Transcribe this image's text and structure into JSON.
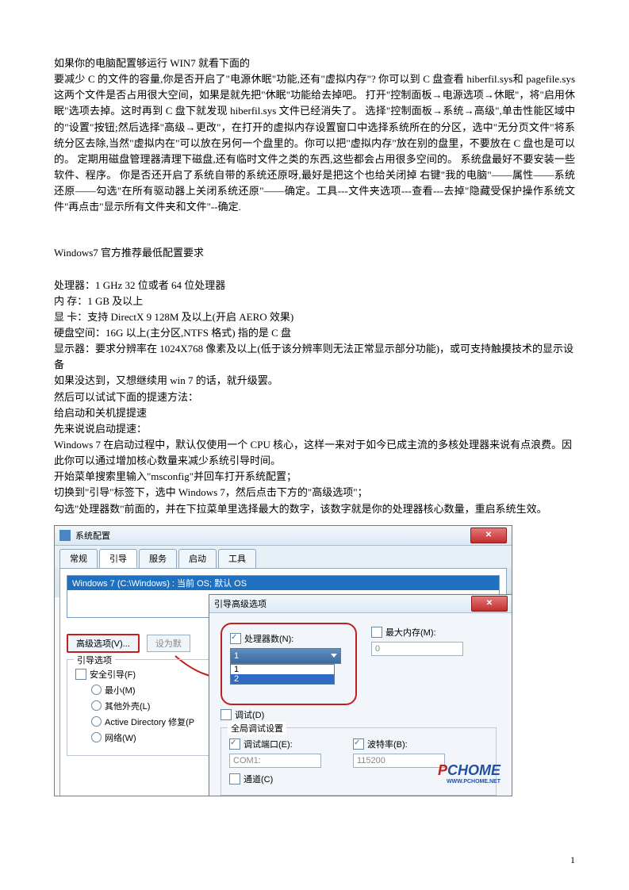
{
  "paragraphs": {
    "p1": "如果你的电脑配置够运行 WIN7 就看下面的",
    "p2": "要减少 C 的文件的容量,你是否开启了\"电源休眠\"功能,还有\"虚拟内存\"? 你可以到 C 盘查看 hiberfil.sys和 pagefile.sys 这两个文件是否占用很大空间，如果是就先把\"休眠\"功能给去掉吧。 打开\"控制面板→电源选项→休眠\"，将\"启用休眠\"选项去掉。这时再到 C 盘下就发现 hiberfil.sys 文件已经消失了。 选择\"控制面板→系统→高级\",单击性能区域中的\"设置\"按钮;然后选择\"高级→更改\"，在打开的虚拟内存设置窗口中选择系统所在的分区，选中\"无分页文件\"将系统分区去除,当然\"虚拟内在\"可以放在另何一个盘里的。你可以把\"虚拟内存\"放在别的盘里，不要放在 C 盘也是可以的。 定期用磁盘管理器清理下磁盘,还有临时文件之类的东西,这些都会占用很多空间的。 系统盘最好不要安装一些软件、程序。 你是否还开启了系统自带的系统还原呀,最好是把这个也给关闭掉  右键\"我的电脑\"——属性——系统还原——勾选\"在所有驱动器上关闭系统还原\"——确定。工具---文件夹选项---查看---去掉\"隐藏受保护操作系统文件\"再点击\"显示所有文件夹和文件\"--确定."
  },
  "section_title": "Windows7 官方推荐最低配置要求",
  "specs": {
    "cpu": "处理器：1   GHz   32 位或者 64 位处理器",
    "ram": "内   存：1   GB   及以上",
    "gpu": "显   卡：支持 DirectX   9   128M   及以上(开启 AERO 效果)",
    "disk": "硬盘空间：16G 以上(主分区,NTFS 格式)   指的是 C 盘",
    "display": "显示器：要求分辨率在 1024X768 像素及以上(低于该分辨率则无法正常显示部分功能)，或可支持触摸技术的显示设备",
    "l1": "如果没达到，又想继续用 win   7 的话，就升级罢。",
    "l2": "然后可以试试下面的提速方法：",
    "l3": "给启动和关机提提速",
    "l4": "先来说说启动提速：",
    "l5": "Windows   7 在启动过程中，默认仅使用一个 CPU 核心，这样一来对于如今已成主流的多核处理器来说有点浪费。因此你可以通过增加核心数量来减少系统引导时间。",
    "l6": "开始菜单搜索里输入\"msconfig\"并回车打开系统配置；",
    "l7": "切换到\"引导\"标签下，选中 Windows   7，然后点击下方的\"高级选项\"；",
    "l8": "勾选\"处理器数\"前面的，并在下拉菜单里选择最大的数字，该数字就是你的处理器核心数量，重启系统生效。"
  },
  "dialog1": {
    "title": "系统配置",
    "tabs": {
      "t1": "常规",
      "t2": "引导",
      "t3": "服务",
      "t4": "启动",
      "t5": "工具"
    },
    "os_entry": "Windows 7 (C:\\Windows) : 当前 OS; 默认 OS",
    "adv_btn": "高级选项(V)...",
    "def_btn": "设为默",
    "fieldset_legend": "引导选项",
    "safe_boot": "安全引导(F)",
    "min": "最小(M)",
    "altshell": "其他外壳(L)",
    "ad": "Active Directory 修复(P",
    "net": "网络(W)"
  },
  "dialog2": {
    "title": "引导高级选项",
    "proc_label": "处理器数(N):",
    "maxmem_label": "最大内存(M):",
    "maxmem_val": "0",
    "dd_sel": "1",
    "dd_opt1": "1",
    "dd_opt2": "2",
    "debug": "调试(D)",
    "global_debug": "全局调试设置",
    "debug_port": "调试端口(E):",
    "com1": "COM1:",
    "baud": "波特率(B):",
    "baud_val": "115200",
    "channel": "通道(C)"
  },
  "logo": {
    "p": "P",
    "c": "CHOME",
    "url": "WWW.PCHOME.NET"
  },
  "pagenum": "1"
}
